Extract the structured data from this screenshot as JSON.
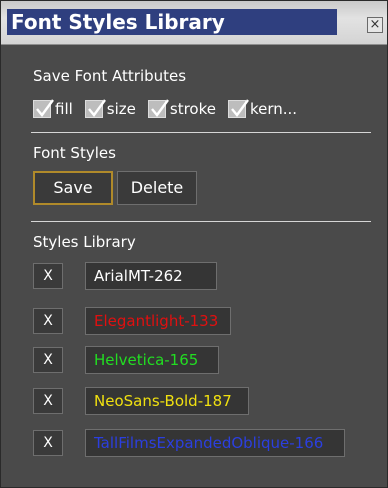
{
  "window": {
    "title": "Font Styles Library",
    "close_icon": "close-icon"
  },
  "save_attributes": {
    "label": "Save Font Attributes",
    "checkboxes": [
      {
        "label": "fill",
        "checked": true
      },
      {
        "label": "size",
        "checked": true
      },
      {
        "label": "stroke",
        "checked": true
      },
      {
        "label": "kern...",
        "checked": true
      }
    ]
  },
  "font_styles": {
    "label": "Font Styles",
    "save_label": "Save",
    "delete_label": "Delete"
  },
  "library": {
    "label": "Styles Library",
    "remove_label": "X",
    "items": [
      {
        "name": "ArialMT-262",
        "color": "#ffffff"
      },
      {
        "name": "Elegantlight-133",
        "color": "#e01010"
      },
      {
        "name": "Helvetica-165",
        "color": "#22dd22"
      },
      {
        "name": "NeoSans-Bold-187",
        "color": "#f0e010"
      },
      {
        "name": "TallFilmsExpandedOblique-166",
        "color": "#2b3fe0"
      }
    ]
  },
  "colors": {
    "panel_bg": "#4a4a4a",
    "title_bg": "#2f3f7f",
    "selected_border": "#b08a2a"
  }
}
